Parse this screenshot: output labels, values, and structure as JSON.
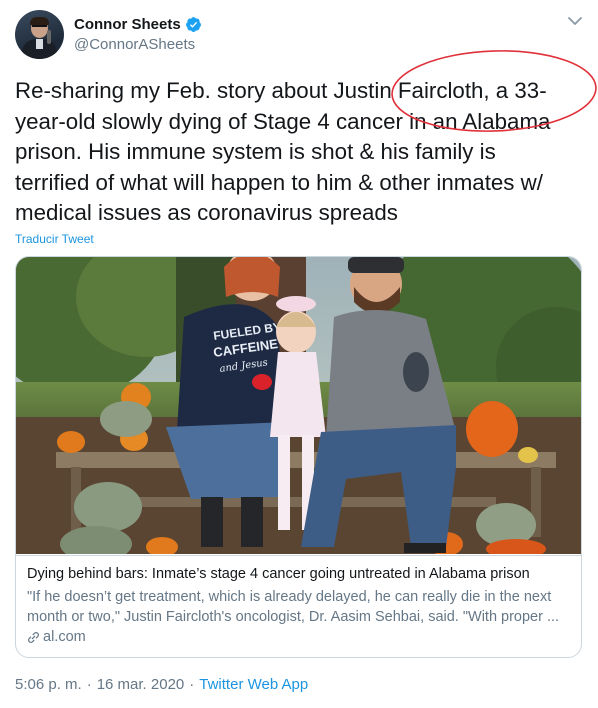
{
  "author": {
    "display_name": "Connor Sheets",
    "handle": "@ConnorASheets",
    "verified": true,
    "avatar_icon": "avatar-photo"
  },
  "tweet": {
    "text": "Re-sharing my Feb. story about Justin Faircloth, a 33-year-old slowly dying of Stage 4 cancer in an Alabama prison. His immune system is shot & his family is terrified of what will happen to him & other inmates w/ medical issues as coronavirus spreads",
    "translate_label": "Traducir Tweet",
    "annotation_color": "#e0313a"
  },
  "card": {
    "title": "Dying behind bars: Inmate’s stage 4 cancer going untreated in Alabama prison",
    "description": "\"If he doesn’t get treatment, which is already delayed, he can really die in the next month or two,\" Justin Faircloth's oncologist, Dr. Aasim Sehbai, said. \"With proper ...",
    "domain": "al.com",
    "shirt_text_line1": "FUELED BY",
    "shirt_text_line2": "CAFFEINE",
    "shirt_text_line3": "and Jesus"
  },
  "meta": {
    "time": "5:06 p. m.",
    "separator": "·",
    "date": "16 mar. 2020",
    "source": "Twitter Web App"
  },
  "colors": {
    "link_blue": "#1b95e0",
    "secondary_text": "#657786",
    "border": "#ccd6dd"
  }
}
